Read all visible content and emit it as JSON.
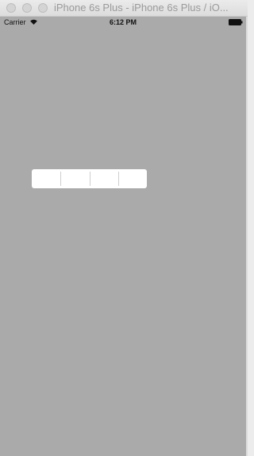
{
  "window": {
    "title": "iPhone 6s Plus - iPhone 6s Plus / iO..."
  },
  "statusbar": {
    "carrier": "Carrier",
    "time": "6:12 PM",
    "wifi_icon": "wifi-icon",
    "battery_icon": "battery-icon"
  },
  "segmented_control": {
    "segments": [
      "",
      "",
      "",
      ""
    ]
  },
  "colors": {
    "screen_background": "#aaaaaa",
    "control_background": "#ffffff",
    "divider": "#cfcfcf"
  }
}
